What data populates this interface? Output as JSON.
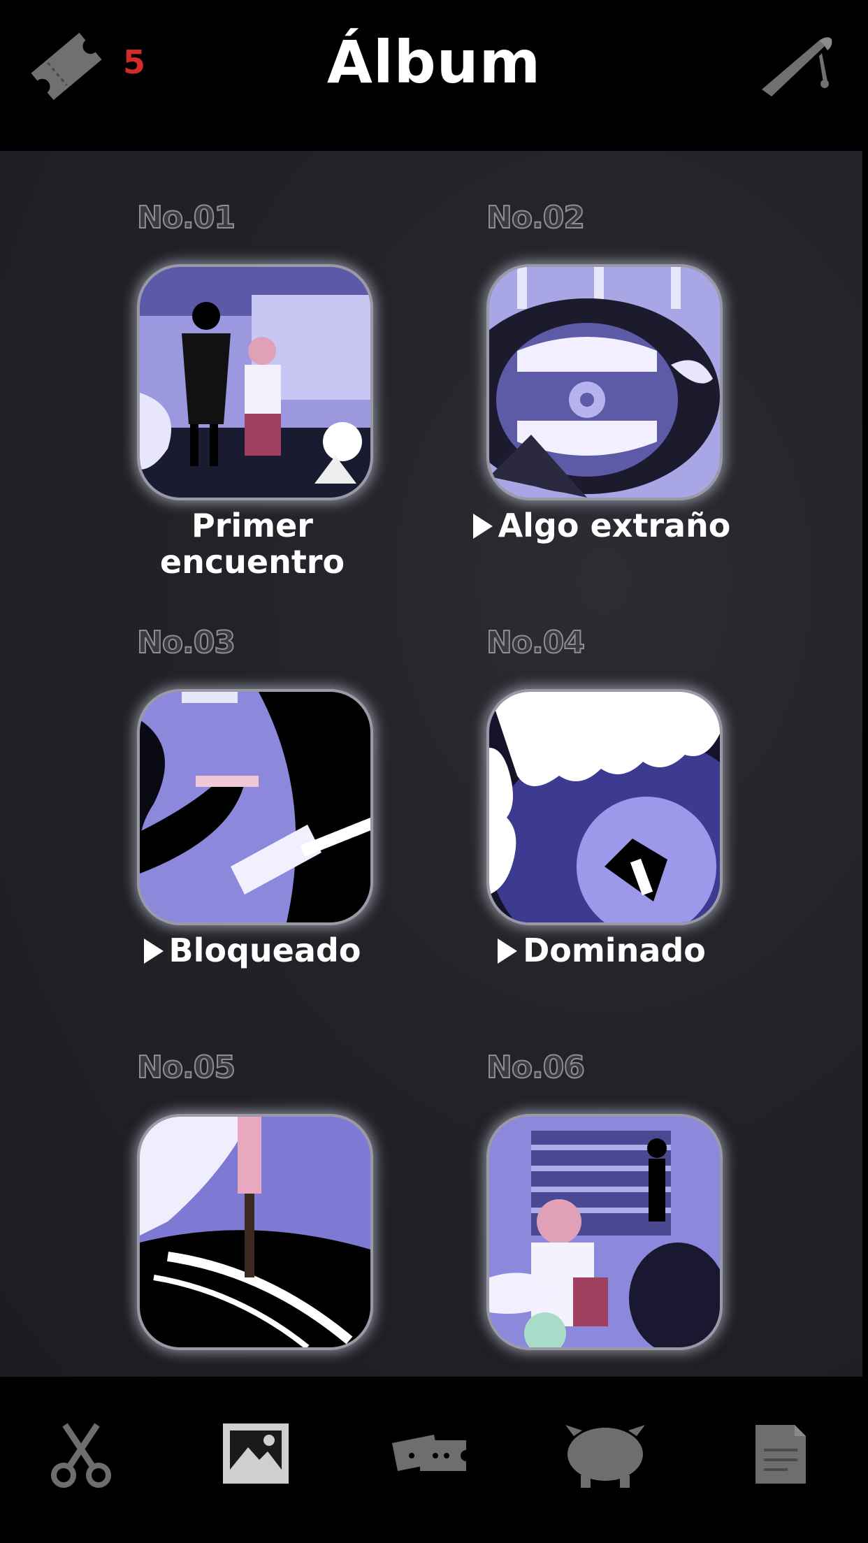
{
  "header": {
    "title": "Álbum",
    "ticket_count": "5",
    "ticket_icon": "ticket-icon",
    "opener_icon": "letter-opener-icon"
  },
  "album": {
    "items": [
      {
        "number": "No.01",
        "label": "Primer encuentro",
        "has_arrow": false
      },
      {
        "number": "No.02",
        "label": "Algo extraño",
        "has_arrow": true
      },
      {
        "number": "No.03",
        "label": "Bloqueado",
        "has_arrow": true
      },
      {
        "number": "No.04",
        "label": "Dominado",
        "has_arrow": true
      },
      {
        "number": "No.05",
        "label": "",
        "has_arrow": false
      },
      {
        "number": "No.06",
        "label": "",
        "has_arrow": false
      }
    ]
  },
  "nav": {
    "items": [
      {
        "icon": "scissors-icon",
        "active": false
      },
      {
        "icon": "photo-album-icon",
        "active": true
      },
      {
        "icon": "tickets-icon",
        "active": false
      },
      {
        "icon": "monster-icon",
        "active": false
      },
      {
        "icon": "notes-icon",
        "active": false
      }
    ]
  },
  "colors": {
    "background": "#000000",
    "panel": "#222228",
    "accent_red": "#d42a2a",
    "thumb_purple": "#8a86d8",
    "icon_gray": "#6e6e6e"
  }
}
